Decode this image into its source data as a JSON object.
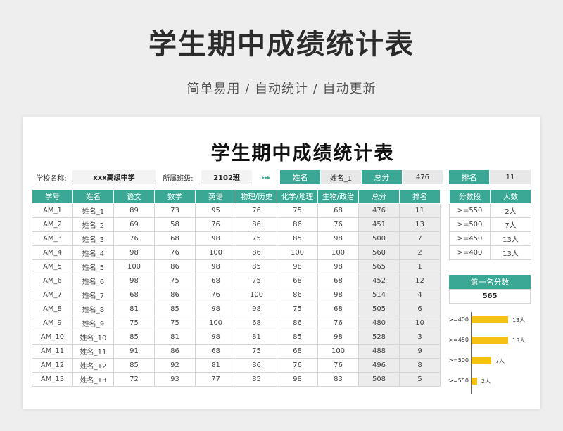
{
  "header": {
    "title": "学生期中成绩统计表",
    "subtitle": "简单易用  /  自动统计  /  自动更新"
  },
  "sheet": {
    "title": "学生期中成绩统计表",
    "info": {
      "school_label": "学校名称:",
      "school_value": "xxx高级中学",
      "class_label": "所属班级:",
      "class_value": "2102班",
      "arrows": "▸▸▸",
      "name_label": "姓名",
      "name_value": "姓名_1",
      "total_label": "总分",
      "total_value": "476",
      "rank_label": "排名",
      "rank_value": "11"
    },
    "table": {
      "headers": [
        "学号",
        "姓名",
        "语文",
        "数学",
        "英语",
        "物理/历史",
        "化学/地理",
        "生物/政治",
        "总分",
        "排名"
      ],
      "rows": [
        [
          "AM_1",
          "姓名_1",
          "89",
          "73",
          "95",
          "76",
          "75",
          "68",
          "476",
          "11"
        ],
        [
          "AM_2",
          "姓名_2",
          "69",
          "58",
          "76",
          "86",
          "86",
          "76",
          "451",
          "13"
        ],
        [
          "AM_3",
          "姓名_3",
          "76",
          "68",
          "98",
          "75",
          "85",
          "98",
          "500",
          "7"
        ],
        [
          "AM_4",
          "姓名_4",
          "98",
          "76",
          "100",
          "86",
          "100",
          "100",
          "560",
          "2"
        ],
        [
          "AM_5",
          "姓名_5",
          "100",
          "86",
          "98",
          "85",
          "98",
          "98",
          "565",
          "1"
        ],
        [
          "AM_6",
          "姓名_6",
          "98",
          "75",
          "68",
          "75",
          "68",
          "68",
          "452",
          "12"
        ],
        [
          "AM_7",
          "姓名_7",
          "68",
          "86",
          "76",
          "100",
          "86",
          "98",
          "514",
          "4"
        ],
        [
          "AM_8",
          "姓名_8",
          "81",
          "85",
          "98",
          "98",
          "75",
          "68",
          "505",
          "6"
        ],
        [
          "AM_9",
          "姓名_9",
          "75",
          "75",
          "100",
          "68",
          "86",
          "76",
          "480",
          "10"
        ],
        [
          "AM_10",
          "姓名_10",
          "85",
          "81",
          "98",
          "81",
          "85",
          "98",
          "528",
          "3"
        ],
        [
          "AM_11",
          "姓名_11",
          "91",
          "86",
          "68",
          "75",
          "68",
          "100",
          "488",
          "9"
        ],
        [
          "AM_12",
          "姓名_12",
          "85",
          "92",
          "81",
          "86",
          "76",
          "76",
          "496",
          "8"
        ],
        [
          "AM_13",
          "姓名_13",
          "72",
          "93",
          "77",
          "85",
          "98",
          "83",
          "508",
          "5"
        ]
      ]
    },
    "segments": {
      "headers": [
        "分数段",
        "人数"
      ],
      "rows": [
        [
          ">=550",
          "2人"
        ],
        [
          ">=500",
          "7人"
        ],
        [
          ">=450",
          "13人"
        ],
        [
          ">=400",
          "13人"
        ]
      ]
    },
    "first_place": {
      "label": "第一名分数",
      "value": "565"
    }
  },
  "chart_data": {
    "type": "bar",
    "orientation": "horizontal",
    "categories": [
      ">=400",
      ">=450",
      ">=500",
      ">=550"
    ],
    "values": [
      13,
      13,
      7,
      2
    ],
    "data_labels": [
      "13人",
      "13人",
      "7人",
      "2人"
    ],
    "xlim": [
      0,
      13
    ],
    "bar_color": "#f5c112"
  },
  "colors": {
    "teal": "#3aa894",
    "bar": "#f5c112"
  }
}
